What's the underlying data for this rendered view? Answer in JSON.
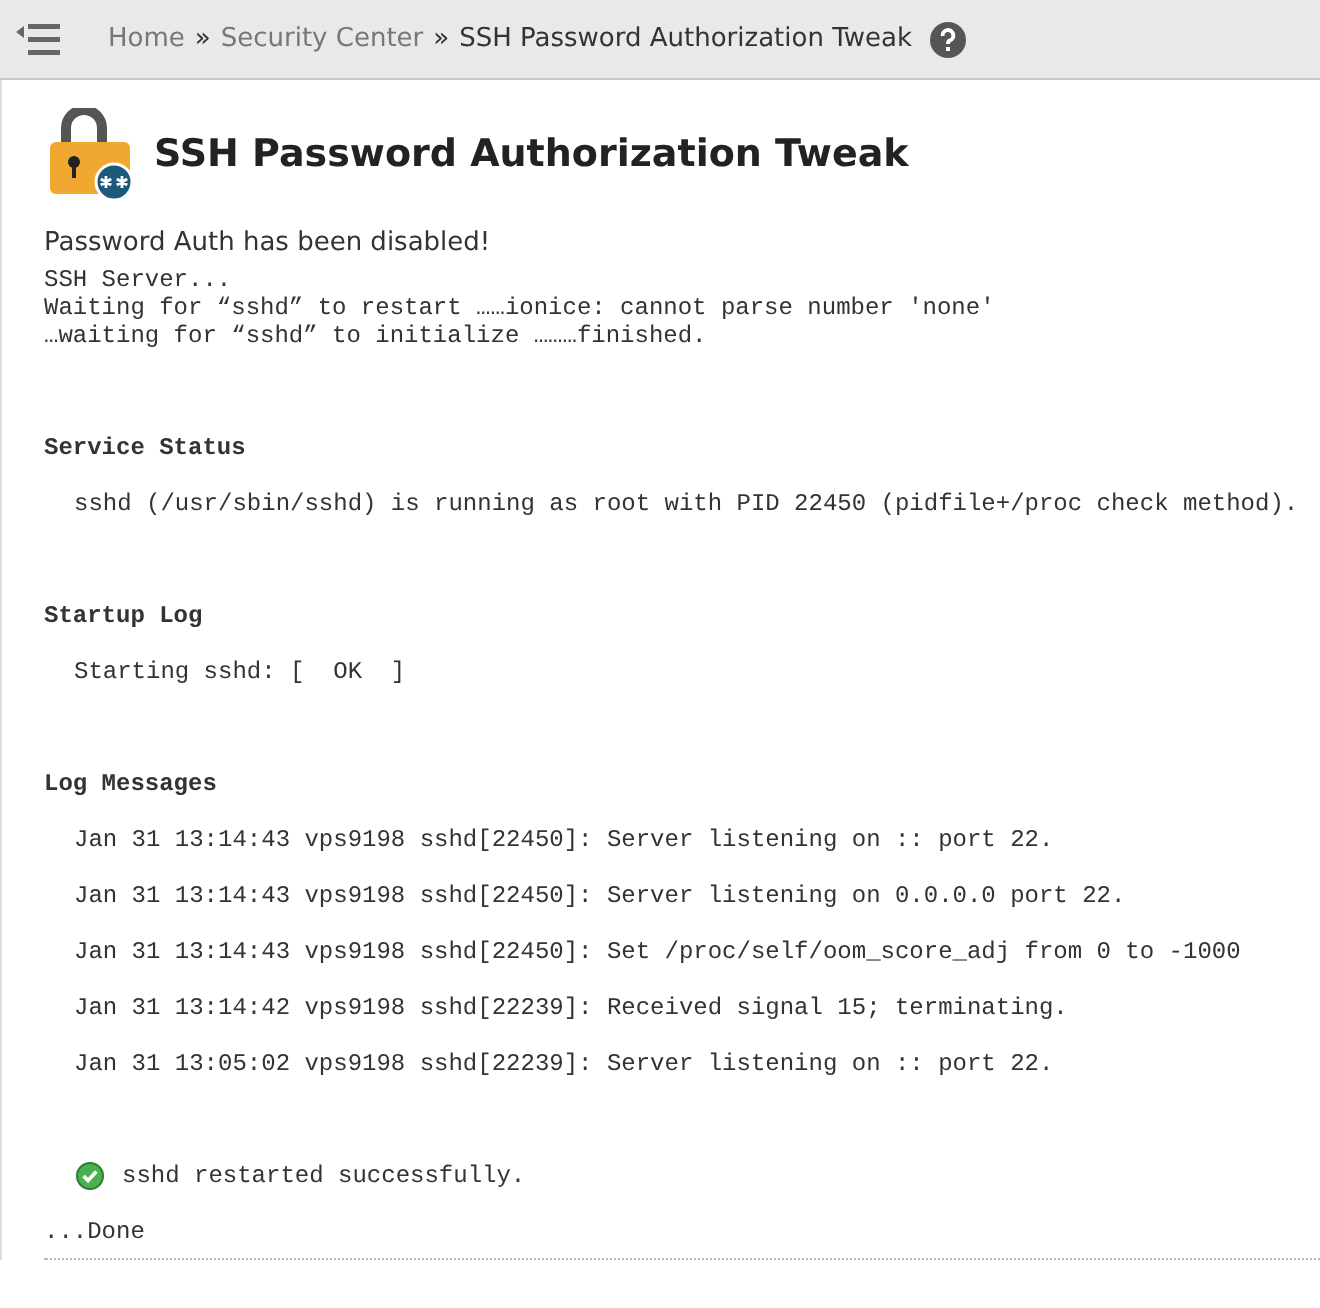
{
  "breadcrumb": [
    {
      "label": "Home",
      "link": true
    },
    {
      "label": "Security Center",
      "link": true
    },
    {
      "label": "SSH Password Authorization Tweak",
      "link": false
    }
  ],
  "separator": "»",
  "title": "SSH Password Authorization Tweak",
  "message": "Password Auth has been disabled!",
  "output": [
    "SSH Server...",
    "Waiting for “sshd” to restart ……ionice: cannot parse number 'none'",
    "…waiting for “sshd” to initialize ………finished."
  ],
  "sections": [
    {
      "heading": "Service Status",
      "lines": [
        "sshd (/usr/sbin/sshd) is running as root with PID 22450 (pidfile+/proc check method)."
      ]
    },
    {
      "heading": "Startup Log",
      "lines": [
        "Starting sshd: [  OK  ]"
      ]
    },
    {
      "heading": "Log Messages",
      "lines": [
        "Jan 31 13:14:43 vps9198 sshd[22450]: Server listening on :: port 22.",
        "Jan 31 13:14:43 vps9198 sshd[22450]: Server listening on 0.0.0.0 port 22.",
        "Jan 31 13:14:43 vps9198 sshd[22450]: Set /proc/self/oom_score_adj from 0 to -1000",
        "Jan 31 13:14:42 vps9198 sshd[22239]: Received signal 15; terminating.",
        "Jan 31 13:05:02 vps9198 sshd[22239]: Server listening on :: port 22."
      ]
    }
  ],
  "success": "sshd restarted successfully.",
  "done": "...Done"
}
